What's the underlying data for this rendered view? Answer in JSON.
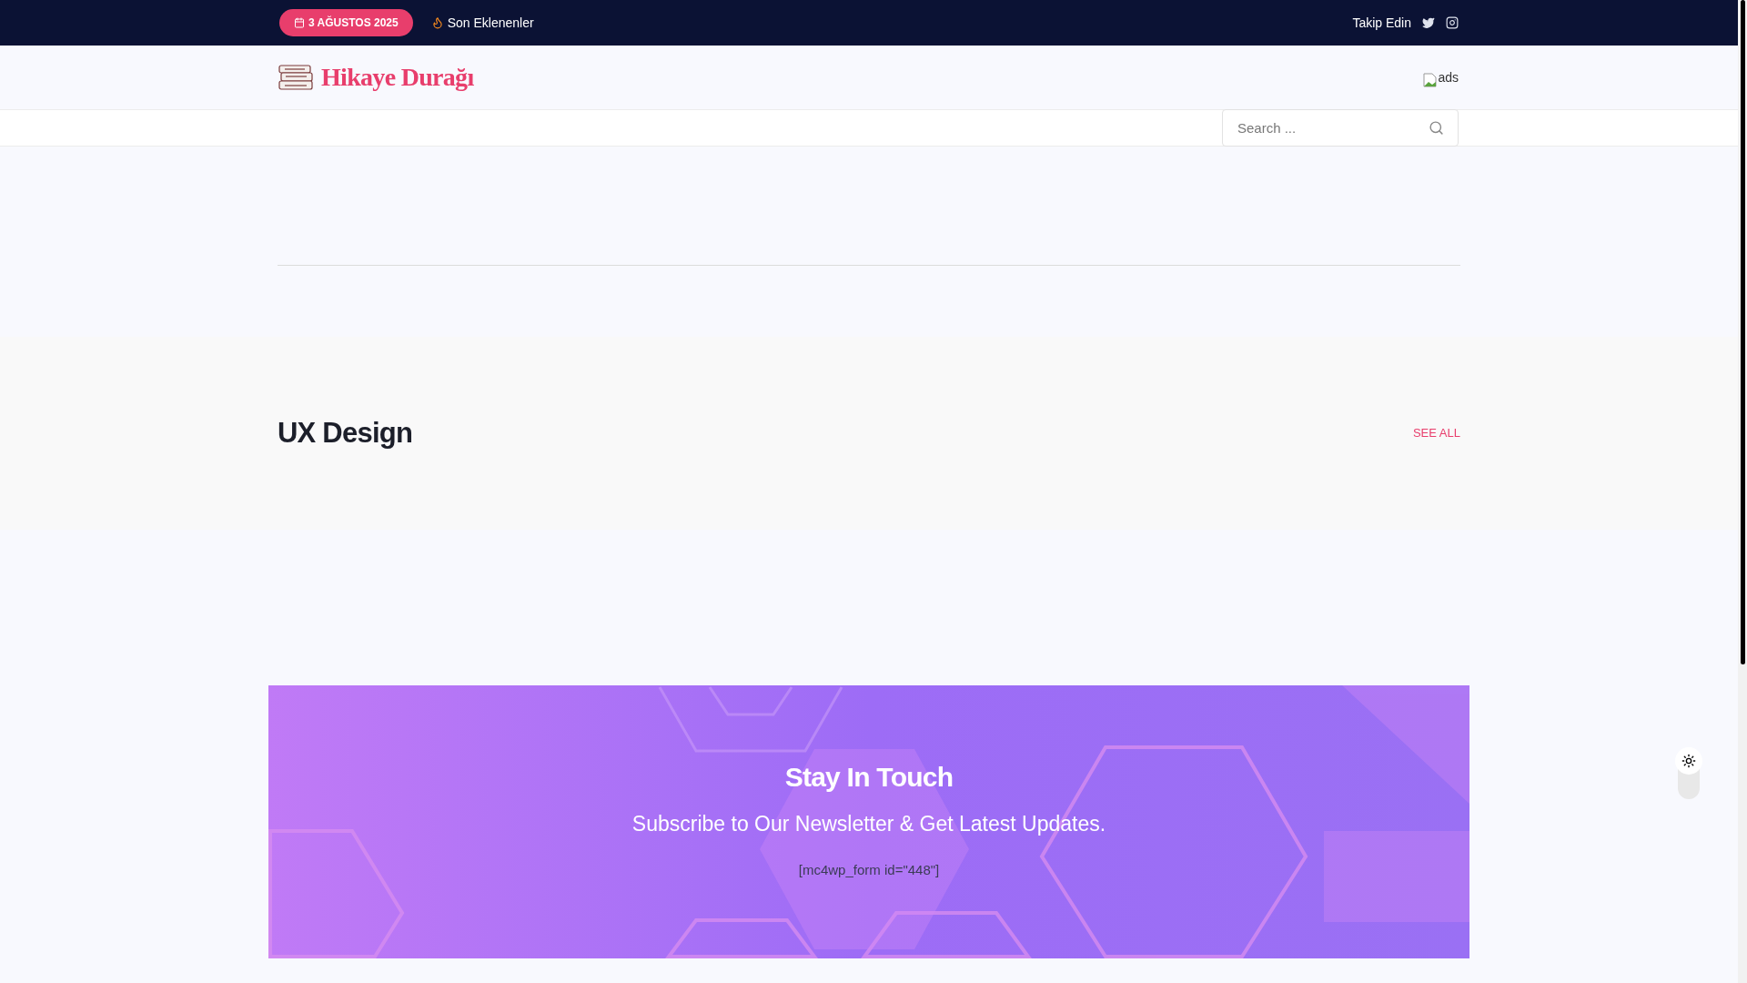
{
  "top_bar": {
    "date": "3 AĞUSTOS 2025",
    "latest_link": "Son Eklenenler",
    "follow_label": "Takip Edin"
  },
  "header": {
    "logo_text": "Hikaye Durağı",
    "ad_alt": "ads"
  },
  "search": {
    "placeholder": "Search ..."
  },
  "section": {
    "title": "UX Design",
    "see_all": "SEE ALL"
  },
  "newsletter": {
    "title": "Stay In Touch",
    "subtitle": "Subscribe to Our Newsletter & Get Latest Updates.",
    "shortcode": "[mc4wp_form id=\"448\"]"
  },
  "theme_toggle": {
    "dark": false
  }
}
